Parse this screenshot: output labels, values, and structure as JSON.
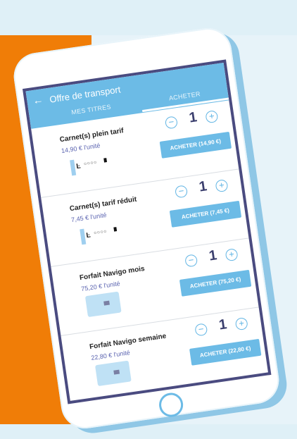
{
  "header": {
    "title": "Offre de transport"
  },
  "tabs": [
    {
      "label": "MES TITRES"
    },
    {
      "label": "ACHETER"
    }
  ],
  "icons": {
    "back": "arrow-left-icon",
    "minus": "minus-circle-icon",
    "plus": "plus-circle-icon",
    "ticket": "ticket-icon",
    "card": "navigo-card-icon"
  },
  "colors": {
    "accent": "#6cbbe6",
    "background_left": "#f07d07",
    "screen_border": "#4a4b80",
    "price": "#5a63b0"
  },
  "products": [
    {
      "name": "Carnet(s) plein tarif",
      "price": "14,90 € l'unité",
      "quantity": "1",
      "button": "ACHETER (14,90 €)",
      "kind": "ticket"
    },
    {
      "name": "Carnet(s) tarif réduit",
      "price": "7,45 € l'unité",
      "quantity": "1",
      "button": "ACHETER (7,45 €)",
      "kind": "ticket"
    },
    {
      "name": "Forfait Navigo mois",
      "price": "75,20 € l'unité",
      "quantity": "1",
      "button": "ACHETER (75,20 €)",
      "kind": "card"
    },
    {
      "name": "Forfait Navigo semaine",
      "price": "22,80 € l'unité",
      "quantity": "1",
      "button": "ACHETER (22,80 €)",
      "kind": "card"
    }
  ]
}
